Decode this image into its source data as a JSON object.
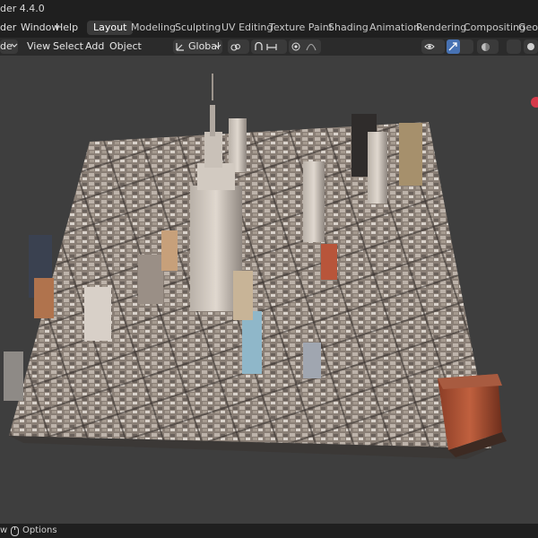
{
  "app": {
    "title": "der 4.4.0"
  },
  "menu": {
    "items": [
      "der",
      "Window",
      "Help"
    ]
  },
  "workspace_tabs": [
    {
      "label": "Layout",
      "active": true
    },
    {
      "label": "Modeling",
      "active": false
    },
    {
      "label": "Sculpting",
      "active": false
    },
    {
      "label": "UV Editing",
      "active": false
    },
    {
      "label": "Texture Paint",
      "active": false
    },
    {
      "label": "Shading",
      "active": false
    },
    {
      "label": "Animation",
      "active": false
    },
    {
      "label": "Rendering",
      "active": false
    },
    {
      "label": "Compositing",
      "active": false
    },
    {
      "label": "Geom",
      "active": false
    }
  ],
  "viewport_header": {
    "mode": "de",
    "menus": [
      "View",
      "Select",
      "Add",
      "Object"
    ],
    "orientation": "Global"
  },
  "statusbar": {
    "left": "w",
    "options": "Options"
  },
  "colors": {
    "background": "#3e3e3e",
    "active_tab": "#3a3a3a",
    "accent_blue": "#4772b3",
    "gizmo_red": "#d63a4a"
  },
  "icons": [
    "transform-orientation-icon",
    "pivot-icon",
    "snap-icon",
    "proportional-edit-icon",
    "visibility-icon",
    "gizmo-icon",
    "shading-icon",
    "viewport-shading-solid-icon"
  ]
}
